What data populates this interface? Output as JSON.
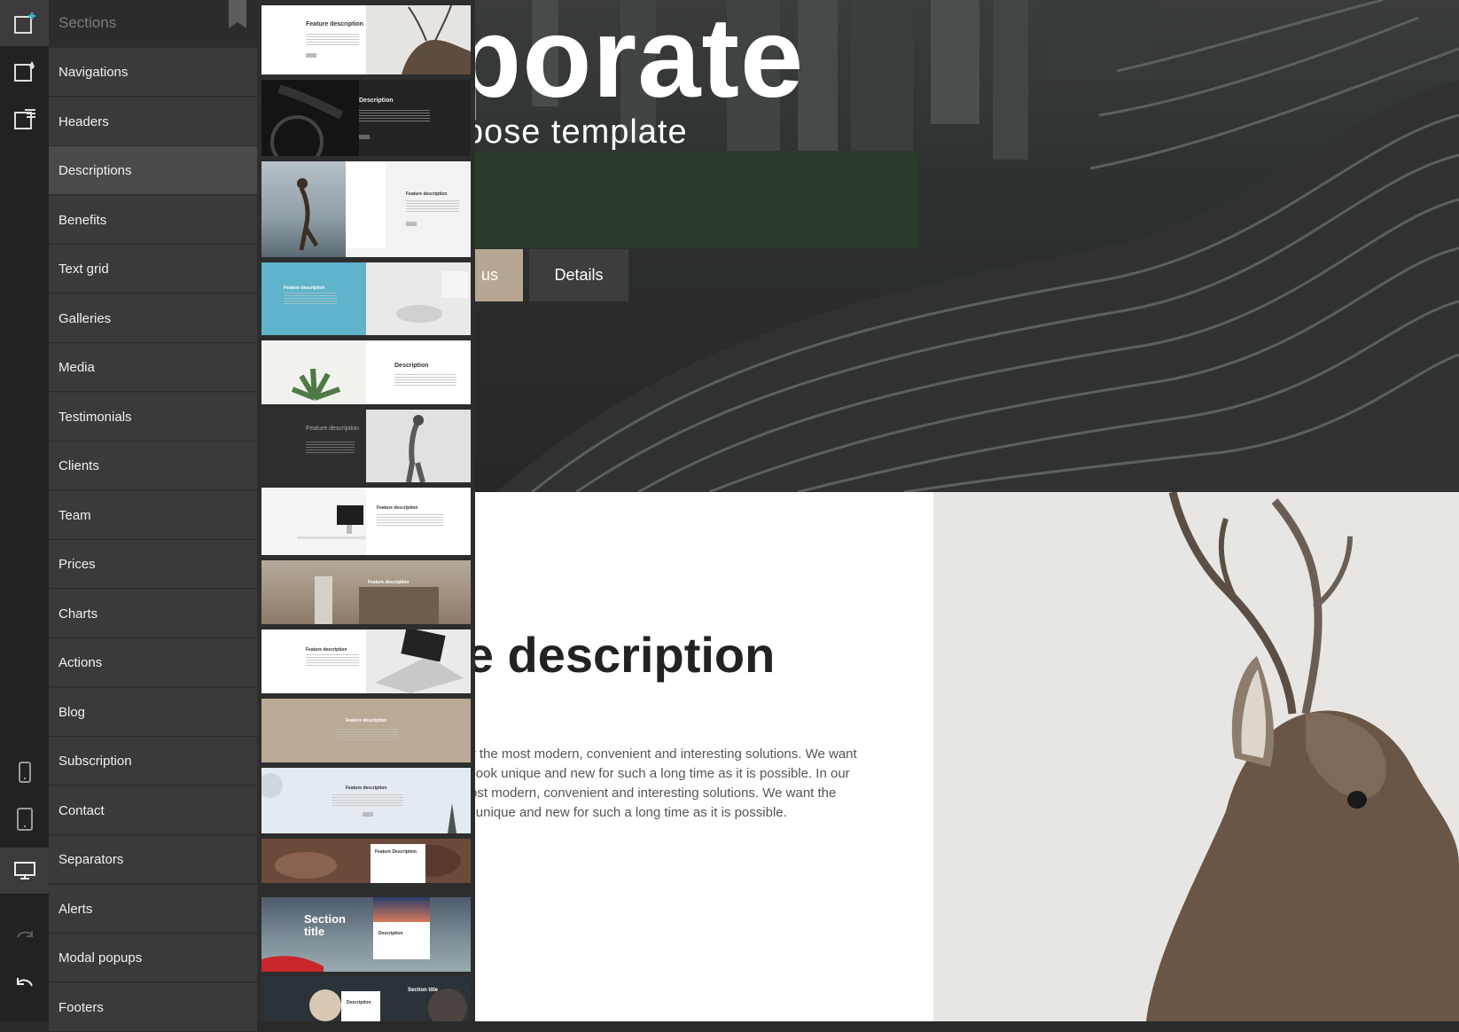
{
  "menu": {
    "header": "Sections",
    "items": [
      {
        "label": "Navigations"
      },
      {
        "label": "Headers"
      },
      {
        "label": "Descriptions"
      },
      {
        "label": "Benefits"
      },
      {
        "label": "Text grid"
      },
      {
        "label": "Galleries"
      },
      {
        "label": "Media"
      },
      {
        "label": "Testimonials"
      },
      {
        "label": "Clients"
      },
      {
        "label": "Team"
      },
      {
        "label": "Prices"
      },
      {
        "label": "Charts"
      },
      {
        "label": "Actions"
      },
      {
        "label": "Blog"
      },
      {
        "label": "Subscription"
      },
      {
        "label": "Contact"
      },
      {
        "label": "Separators"
      },
      {
        "label": "Alerts"
      },
      {
        "label": "Modal popups"
      },
      {
        "label": "Footers"
      }
    ],
    "active": "Descriptions"
  },
  "toolbar": {
    "icons": [
      "add-section-icon",
      "color-theme-icon",
      "page-settings-icon",
      "mobile-view-icon",
      "tablet-view-icon",
      "desktop-view-icon",
      "redo-icon",
      "undo-icon"
    ],
    "active_view": "desktop"
  },
  "thumbnails": [
    {
      "title": "Feature description"
    },
    {
      "title": "Description"
    },
    {
      "title": "Feature description"
    },
    {
      "title": "Feature description"
    },
    {
      "title": "Description"
    },
    {
      "title": "Feature description"
    },
    {
      "title": "Feature description"
    },
    {
      "title": "Feature description"
    },
    {
      "title": "Feature description"
    },
    {
      "title": "Feature description"
    },
    {
      "title": "Feature description"
    },
    {
      "title": "Feature Description"
    },
    {
      "title": "Section title",
      "subtitle": "Description"
    },
    {
      "title": "Description",
      "subtitle": "Section title"
    }
  ],
  "hero": {
    "title": "orporate",
    "subtitle": "purpose template",
    "contact_button": "us",
    "details_button": "Details"
  },
  "feature": {
    "title": "ature description",
    "text_lines": [
      "we try to use only the most modern, convenient and interesting solutions. We want",
      "you downloaded look unique and new for such a long time as it is possible. In our",
      "o use only the most modern, convenient and interesting solutions. We want the",
      " downloaded look unique and new for such a long time as it is possible."
    ]
  },
  "colors": {
    "accent": "#b5a793",
    "menu_bg": "#3a3a3a",
    "toolbar_bg": "#222222",
    "add_icon_accent": "#3fb2e0"
  }
}
